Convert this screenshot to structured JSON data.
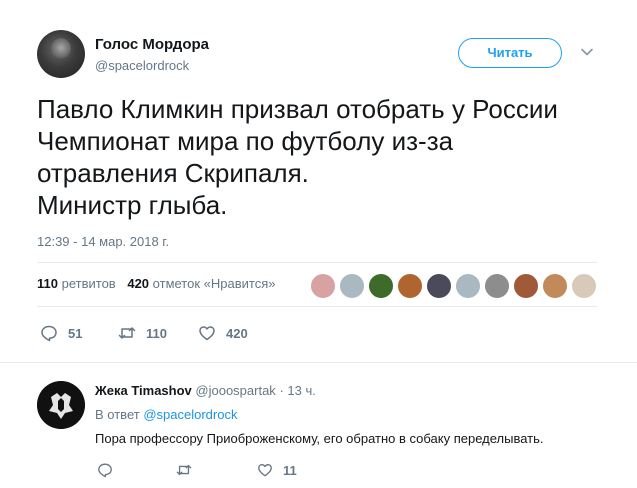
{
  "tweet": {
    "author_name": "Голос Мордора",
    "author_handle": "@spacelordrock",
    "follow_label": "Читать",
    "text_lines": [
      "Павло Климкин призвал отобрать у России",
      "Чемпионат мира по футболу из-за",
      "отравления Скрипаля.",
      "Министр глыба."
    ],
    "timestamp": "12:39 - 14 мар. 2018 г.",
    "stats": {
      "retweets_count": "110",
      "retweets_label": "ретвитов",
      "likes_count": "420",
      "likes_label": "отметок «Нравится»"
    },
    "likers": [
      {
        "color": "#d9a2a2"
      },
      {
        "color": "#aab8c2"
      },
      {
        "color": "#3e6b2a"
      },
      {
        "color": "#b0652f"
      },
      {
        "color": "#4a4a5a"
      },
      {
        "color": "#aab8c2"
      },
      {
        "color": "#8d8d8d"
      },
      {
        "color": "#a05a3a"
      },
      {
        "color": "#c28a5a"
      },
      {
        "color": "#d9c9b8"
      }
    ],
    "actions": {
      "reply_count": "51",
      "retweet_count": "110",
      "like_count": "420"
    }
  },
  "reply": {
    "author_name": "Жека Timashov",
    "author_handle": "@jooospartak",
    "dot": "·",
    "time": "13 ч.",
    "in_reply_prefix": "В ответ",
    "in_reply_handle": "@spacelordrock",
    "text": "Пора профессору Приоброженскому,  его обратно в собаку переделывать.",
    "actions": {
      "reply_count": "",
      "retweet_count": "",
      "like_count": "11"
    }
  },
  "colors": {
    "accent": "#1da1f2",
    "secondary_text": "#657786",
    "divider": "#e6ecf0"
  }
}
